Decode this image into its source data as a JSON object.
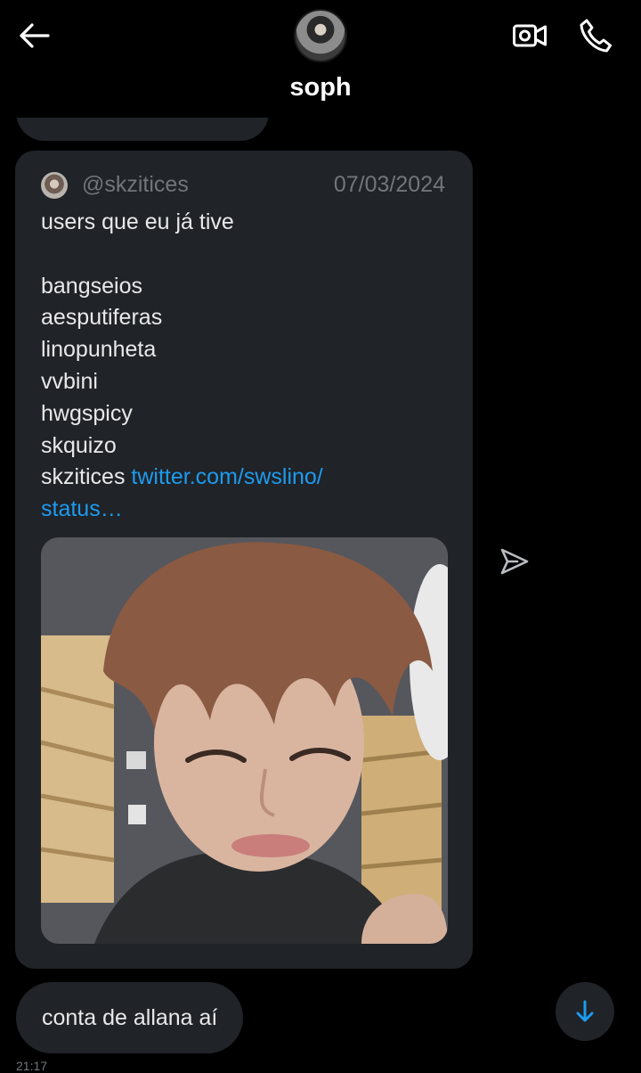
{
  "header": {
    "name": "soph",
    "avatar_icon": "user-avatar",
    "back_icon": "arrow-left-icon",
    "video_icon": "video-camera-icon",
    "phone_icon": "phone-icon"
  },
  "tweet": {
    "handle": "@skzitices",
    "date": "07/03/2024",
    "lines": [
      "users que eu já tive",
      "",
      "bangseios",
      "aesputiferas",
      "linopunheta",
      "vvbini",
      "hwgspicy",
      "skquizo"
    ],
    "last_line_text": "skzitices",
    "link_part1": "twitter.com/swslino/",
    "link_part2": "status…",
    "media_description_icon": "photo-thumbnail"
  },
  "message": {
    "text": "conta de allana aí",
    "time": "21:17"
  },
  "colors": {
    "background": "#000000",
    "bubble": "#202327",
    "text": "#e7e9ea",
    "muted": "#71767b",
    "link": "#1d9bf0"
  }
}
